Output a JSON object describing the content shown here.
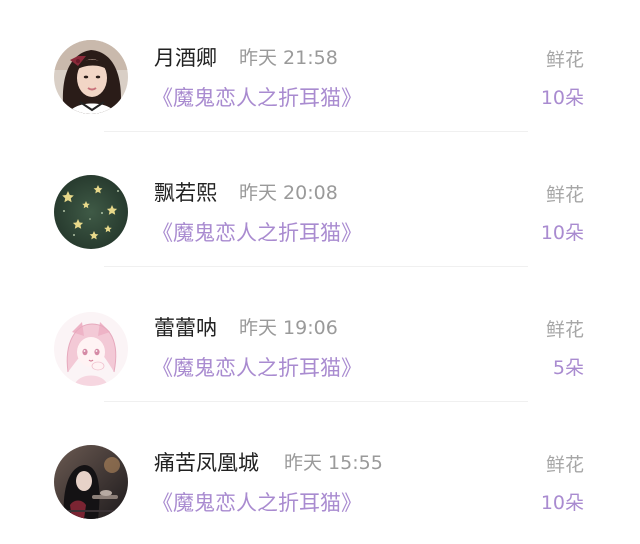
{
  "entries": [
    {
      "username": "月酒卿",
      "time": "昨天 21:58",
      "book": "《魔鬼恋人之折耳猫》",
      "gift_label": "鲜花",
      "gift_count": "10朵",
      "avatar_icon": "avatar-girl-photo-icon"
    },
    {
      "username": "飘若熙",
      "time": "昨天 20:08",
      "book": "《魔鬼恋人之折耳猫》",
      "gift_label": "鲜花",
      "gift_count": "10朵",
      "avatar_icon": "avatar-green-stars-icon"
    },
    {
      "username": "蕾蕾呐",
      "time": "昨天 19:06",
      "book": "《魔鬼恋人之折耳猫》",
      "gift_label": "鲜花",
      "gift_count": "5朵",
      "avatar_icon": "avatar-pink-anime-girl-icon"
    },
    {
      "username": "痛苦凤凰城",
      "time": "昨天 15:55",
      "book": "《魔鬼恋人之折耳猫》",
      "gift_label": "鲜花",
      "gift_count": "10朵",
      "avatar_icon": "avatar-dark-illustration-icon"
    }
  ],
  "colors": {
    "accent": "#a98bd0",
    "name_text": "#222222",
    "muted_text": "#9a9a9a"
  }
}
